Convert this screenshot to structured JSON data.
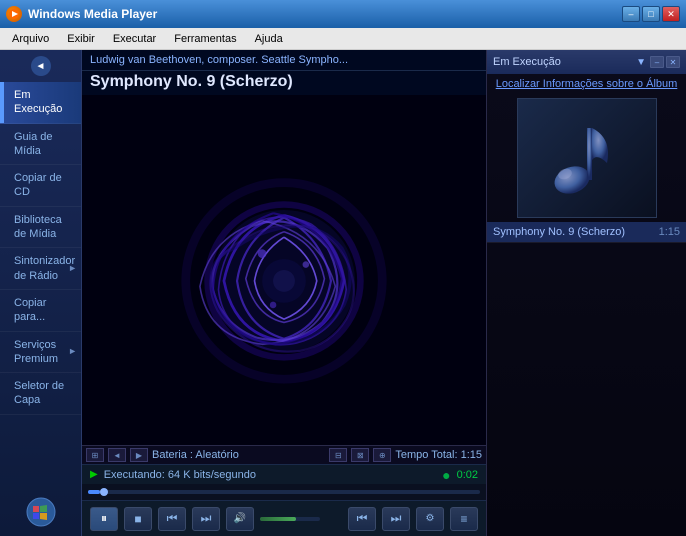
{
  "titleBar": {
    "title": "Windows Media Player",
    "minLabel": "–",
    "maxLabel": "□",
    "closeLabel": "✕"
  },
  "menuBar": {
    "items": [
      "Arquivo",
      "Exibir",
      "Executar",
      "Ferramentas",
      "Ajuda"
    ]
  },
  "sidebar": {
    "navArrow": "◄",
    "items": [
      {
        "id": "em-execucao",
        "label": "Em Execução",
        "active": true
      },
      {
        "id": "guia-de-midia",
        "label": "Guia de Mídia",
        "active": false
      },
      {
        "id": "copiar-de-cd",
        "label": "Copiar de CD",
        "active": false
      },
      {
        "id": "biblioteca-de-midia",
        "label": "Biblioteca de Mídia",
        "active": false
      },
      {
        "id": "sintonizador-de-radio",
        "label": "Sintonizador de Rádio",
        "active": false,
        "hasArrow": true
      },
      {
        "id": "copiar-para",
        "label": "Copiar para...",
        "active": false
      },
      {
        "id": "servicos-premium",
        "label": "Serviços Premium",
        "active": false,
        "hasArrow": true
      },
      {
        "id": "seletor-de-capa",
        "label": "Seletor de Capa",
        "active": false
      }
    ]
  },
  "videoArea": {
    "headerText": "Ludwig van Beethoven, composer. Seattle Sympho...",
    "title": "Symphony No. 9 (Scherzo)"
  },
  "bottomBar": {
    "vizIconLeft": "⊞",
    "vizIconLeft2": "◄",
    "playMode": "▶",
    "bateriaLabel": "Bateria : Aleatório",
    "iconRight1": "⊠",
    "iconRight2": "⊟",
    "iconRight3": "⊕",
    "tempoTotal": "Tempo Total: 1:15"
  },
  "statusBar": {
    "playIcon": "▶",
    "statusText": "Executando: 64 K bits/segundo",
    "timeCurrentDot": "●",
    "timeCurrent": "0:02"
  },
  "transportBar": {
    "pauseBtn": "⏸",
    "stopBtn": "■",
    "prevBtn": "⏮",
    "nextBtn": "⏭",
    "volumeIcon": "🔊",
    "skipBackBtn": "⏮",
    "skipFwdBtn": "⏭",
    "repeatBtn": "↻",
    "settingsBtn": "⚙",
    "moreBtn": "≡"
  },
  "rightPanel": {
    "title": "Em Execução",
    "dropdownIcon": "▼",
    "minimizeBtn": "–",
    "closeBtn": "✕",
    "findInfoText": "Localizar Informações sobre o Álbum",
    "musicNote": "♪",
    "playlistItems": [
      {
        "title": "Symphony No. 9 (Scherzo)",
        "duration": "1:15",
        "active": true
      }
    ]
  }
}
